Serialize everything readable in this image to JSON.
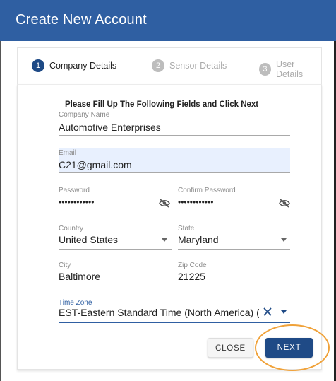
{
  "dialog": {
    "title": "Create New Account"
  },
  "stepper": {
    "steps": [
      {
        "number": "1",
        "label": "Company Details"
      },
      {
        "number": "2",
        "label": "Sensor Details"
      },
      {
        "number": "3",
        "label": "User Details"
      }
    ],
    "active_step": 1
  },
  "form": {
    "heading": "Please Fill Up The Following Fields and Click Next",
    "company_name": {
      "label": "Company Name",
      "value": "Automotive Enterprises"
    },
    "email": {
      "label": "Email",
      "value": "C21@gmail.com"
    },
    "password": {
      "label": "Password",
      "value": "••••••••••••"
    },
    "confirm_password": {
      "label": "Confirm Password",
      "value": "••••••••••••"
    },
    "country": {
      "label": "Country",
      "value": "United States"
    },
    "state": {
      "label": "State",
      "value": "Maryland"
    },
    "city": {
      "label": "City",
      "value": "Baltimore"
    },
    "zip_code": {
      "label": "Zip Code",
      "value": "21225"
    },
    "time_zone": {
      "label": "Time Zone",
      "value": "EST-Eastern Standard Time (North America) (UTC-"
    }
  },
  "actions": {
    "close_label": "CLOSE",
    "next_label": "NEXT"
  },
  "colors": {
    "header": "#2f5fa2",
    "primary": "#1f4a86",
    "highlight": "#f0a23a",
    "autofill": "#e8f0fe"
  },
  "icons": {
    "password_toggle": "eye-off-icon",
    "dropdown": "chevron-down-icon",
    "clear": "close-icon"
  }
}
